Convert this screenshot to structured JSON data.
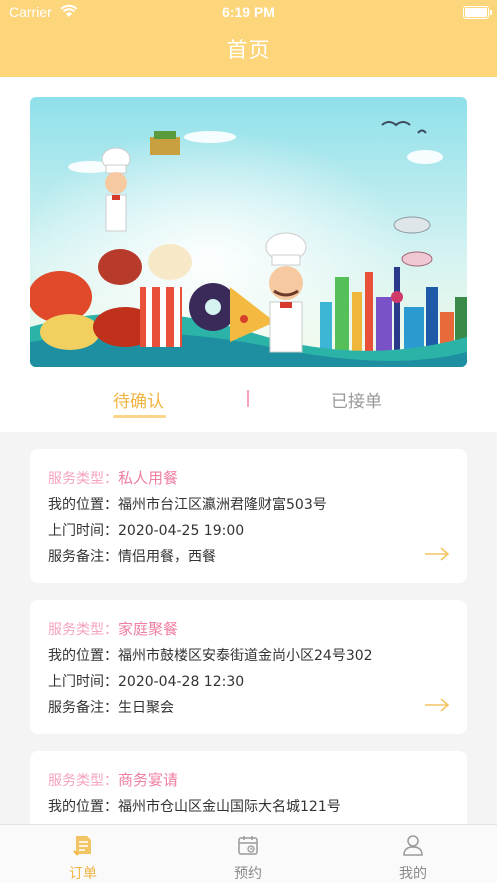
{
  "status_bar": {
    "carrier": "Carrier",
    "time": "6:19 PM"
  },
  "header": {
    "title": "首页"
  },
  "tabs": [
    {
      "label": "待确认",
      "active": true
    },
    {
      "label": "已接单",
      "active": false
    }
  ],
  "orders": [
    {
      "type_label": "服务类型：",
      "type": "私人用餐",
      "location_label": "我的位置：",
      "location": "福州市台江区瀛洲君隆财富503号",
      "time_label": "上门时间：",
      "time": "2020-04-25 19:00",
      "note_label": "服务备注：",
      "note": "情侣用餐，西餐"
    },
    {
      "type_label": "服务类型：",
      "type": "家庭聚餐",
      "location_label": "我的位置：",
      "location": "福州市鼓楼区安泰街道金尚小区24号302",
      "time_label": "上门时间：",
      "time": "2020-04-28 12:30",
      "note_label": "服务备注：",
      "note": "生日聚会"
    },
    {
      "type_label": "服务类型：",
      "type": "商务宴请",
      "location_label": "我的位置：",
      "location": "福州市仓山区金山国际大名城121号"
    }
  ],
  "bottom_nav": [
    {
      "label": "订单",
      "icon": "order-icon",
      "active": true
    },
    {
      "label": "预约",
      "icon": "calendar-icon",
      "active": false
    },
    {
      "label": "我的",
      "icon": "person-icon",
      "active": false
    }
  ],
  "colors": {
    "header": "#fdd57a",
    "accent": "#f0b440",
    "pink": "#f07fa0",
    "background": "#f4f4f4"
  }
}
